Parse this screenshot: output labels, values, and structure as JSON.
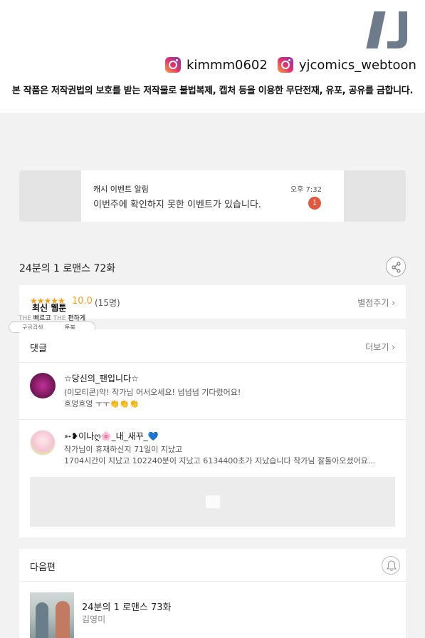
{
  "header": {
    "instagram": [
      {
        "icon": "instagram-icon",
        "handle": "kimmm0602"
      },
      {
        "icon": "instagram-icon",
        "handle": "yjcomics_webtoon"
      }
    ],
    "copyright": "본 작품은 저작권법의 보호를 받는 저작물로 불법복제, 캡처 등을 이용한 무단전재, 유포, 공유를 금합니다."
  },
  "notification": {
    "title": "캐시 이벤트 알림",
    "time": "오후 7:32",
    "body": "이번주에 확인하지 못한 이벤트가 있습니다.",
    "badge": "1"
  },
  "episode": {
    "title": "24분의 1 로맨스 72화",
    "stars": "★★★★★",
    "score": "10.0",
    "rater_count": "(15명)",
    "rate_link": "별점주기 ›"
  },
  "floating_badge": {
    "title": "최신 웹툰",
    "sub_the1": "THE",
    "sub_fast": "빠르고",
    "sub_the2": "THE",
    "sub_comfort": "편하게",
    "pill_google": "구글검색",
    "pill_toonbook": "툰북"
  },
  "comments": {
    "heading": "댓글",
    "more": "더보기 ›",
    "items": [
      {
        "name": "☆당신의_팬입니다☆",
        "line1": "(이모티콘)악! 작가님 어서오세요! 넘넘넘 기다렸어요!",
        "line2": "흐엉흐엉 ㅜㅜ👏👏👏"
      },
      {
        "name": "➵❥이나ღ🌸_내_새꾸_💙",
        "line1": "작가님이 휴재하신지 71일이 지났고",
        "line2": "1704시간이 지났고 102240분이 지났고 6134400초가 지났습니다 작가님 잘돌아오셨어요..."
      }
    ]
  },
  "next": {
    "heading": "다음편",
    "title": "24분의 1 로맨스 73화",
    "author": "김영미"
  },
  "colors": {
    "accent_orange": "#f2a01a",
    "badge_red": "#e2583e",
    "logo_gray": "#6d7b8a"
  }
}
